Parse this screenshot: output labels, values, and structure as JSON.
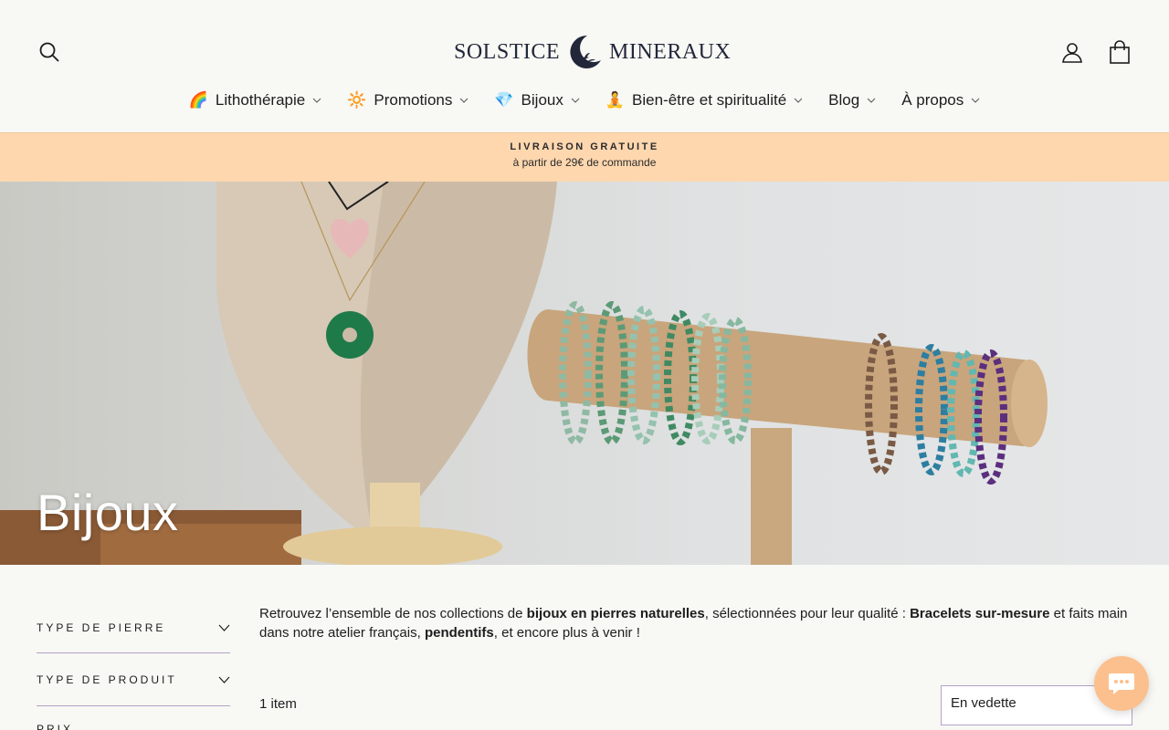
{
  "header": {
    "logo_left": "SOLSTICE",
    "logo_right": "MINERAUX",
    "nav": [
      {
        "emoji": "🌈",
        "label": "Lithothérapie"
      },
      {
        "emoji": "🔆",
        "label": "Promotions"
      },
      {
        "emoji": "💎",
        "label": "Bijoux"
      },
      {
        "emoji": "🧘",
        "label": "Bien-être et spiritualité"
      },
      {
        "emoji": "",
        "label": "Blog"
      },
      {
        "emoji": "",
        "label": "À propos"
      }
    ]
  },
  "announcement": {
    "title": "LIVRAISON GRATUITE",
    "subtitle": "à partir de 29€ de commande"
  },
  "hero": {
    "title": "Bijoux"
  },
  "filters": [
    {
      "label": "TYPE DE PIERRE"
    },
    {
      "label": "TYPE DE PRODUIT"
    },
    {
      "label": "PRIX"
    }
  ],
  "description": {
    "p1": "Retrouvez l’ensemble de nos collections de ",
    "b1": "bijoux en pierres naturelles",
    "p2": ", sélectionnées pour leur qualité : ",
    "b2": "Bracelets sur-mesure",
    "p3": " et faits main dans notre atelier français, ",
    "b3": "pendentifs",
    "p4": ", et encore plus à venir !"
  },
  "listing": {
    "count": "1 item",
    "sort_value": "En vedette"
  },
  "colors": {
    "announcement_bg": "#fed7af",
    "accent_border": "#b4a2c7",
    "chat_bg": "#fcc08e",
    "page_bg": "#f8f8f4"
  }
}
